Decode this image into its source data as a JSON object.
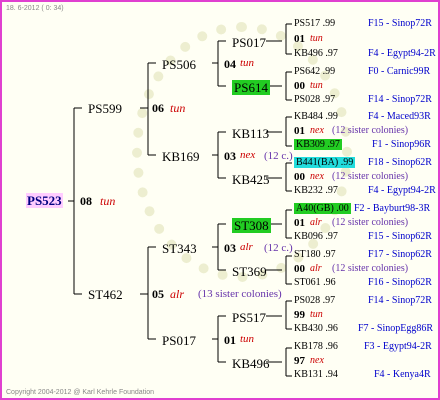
{
  "header": "18. 6-2012 ( 0: 34)",
  "footer": "Copyright 2004-2012 @ Karl Kehrle Foundation",
  "root": {
    "name": "PS523",
    "gen": "08",
    "trait": "tun"
  },
  "g1": [
    {
      "name": "PS599",
      "gen": "06",
      "trait": "tun"
    },
    {
      "name": "ST462",
      "gen": "05",
      "trait": "alr",
      "sister": "(13 sister colonies)"
    }
  ],
  "g2": [
    {
      "name": "PS506",
      "gen": "04",
      "trait": "tun"
    },
    {
      "name": "KB169",
      "gen": "03",
      "trait": "nex",
      "sister": "(12 c.)"
    },
    {
      "name": "ST343",
      "gen": "03",
      "trait": "alr",
      "sister": "(12 c.)"
    },
    {
      "name": "PS017",
      "gen": "01",
      "trait": "tun"
    }
  ],
  "g3": [
    {
      "name": "PS017",
      "gen": "00",
      "trait": "tun"
    },
    {
      "name": "PS614",
      "gen": "",
      "trait": ""
    },
    {
      "name": "KB113",
      "gen": "",
      "trait": ""
    },
    {
      "name": "KB425",
      "gen": "",
      "trait": ""
    },
    {
      "name": "ST308",
      "gen": "",
      "trait": ""
    },
    {
      "name": "ST369",
      "gen": "",
      "trait": ""
    },
    {
      "name": "PS517",
      "gen": "",
      "trait": ""
    },
    {
      "name": "KB496",
      "gen": "",
      "trait": ""
    }
  ],
  "g4_traits": [
    {
      "gen": "01",
      "trait": "tun",
      "sister": ""
    },
    {
      "gen": "00",
      "trait": "tun",
      "sister": ""
    },
    {
      "gen": "01",
      "trait": "nex",
      "sister": "(12 sister colonies)"
    },
    {
      "gen": "00",
      "trait": "nex",
      "sister": "(12 sister colonies)"
    },
    {
      "gen": "01",
      "trait": "alr",
      "sister": "(12 sister colonies)"
    },
    {
      "gen": "00",
      "trait": "alr",
      "sister": "(12 sister colonies)"
    },
    {
      "gen": "99",
      "trait": "tun",
      "sister": ""
    },
    {
      "gen": "97",
      "trait": "nex",
      "sister": ""
    }
  ],
  "g4_rows": [
    {
      "name": "PS517",
      "year": ".99",
      "info": "F15 - Sinop72R"
    },
    {
      "name": "KB496",
      "year": ".97",
      "info": "F4 - Egypt94-2R"
    },
    {
      "name": "PS642",
      "year": ".99",
      "info": "F0 - Carnic99R"
    },
    {
      "name": "PS028",
      "year": ".97",
      "info": "F14 - Sinop72R"
    },
    {
      "name": "KB484",
      "year": ".99",
      "info": "F4 - Maced93R"
    },
    {
      "name": "KB309",
      "year": ".97",
      "info": "F1 - Sinop96R"
    },
    {
      "name": "B441(BA)",
      "year": ".99",
      "info": "F18 - Sinop62R"
    },
    {
      "name": "KB232",
      "year": ".97",
      "info": "F4 - Egypt94-2R"
    },
    {
      "name": "A40(GB)",
      "year": ".00",
      "info": "F2 - Bayburt98-3R"
    },
    {
      "name": "KB096",
      "year": ".97",
      "info": "F15 - Sinop62R"
    },
    {
      "name": "ST180",
      "year": ".97",
      "info": "F17 - Sinop62R"
    },
    {
      "name": "ST061",
      "year": ".96",
      "info": "F16 - Sinop62R"
    },
    {
      "name": "PS028",
      "year": ".97",
      "info": "F14 - Sinop72R"
    },
    {
      "name": "KB430",
      "year": ".96",
      "info": "F7 - SinopEgg86R"
    },
    {
      "name": "KB178",
      "year": ".96",
      "info": "F3 - Egypt94-2R"
    },
    {
      "name": "KB131",
      "year": ".94",
      "info": "F4 - Kenya4R"
    }
  ]
}
